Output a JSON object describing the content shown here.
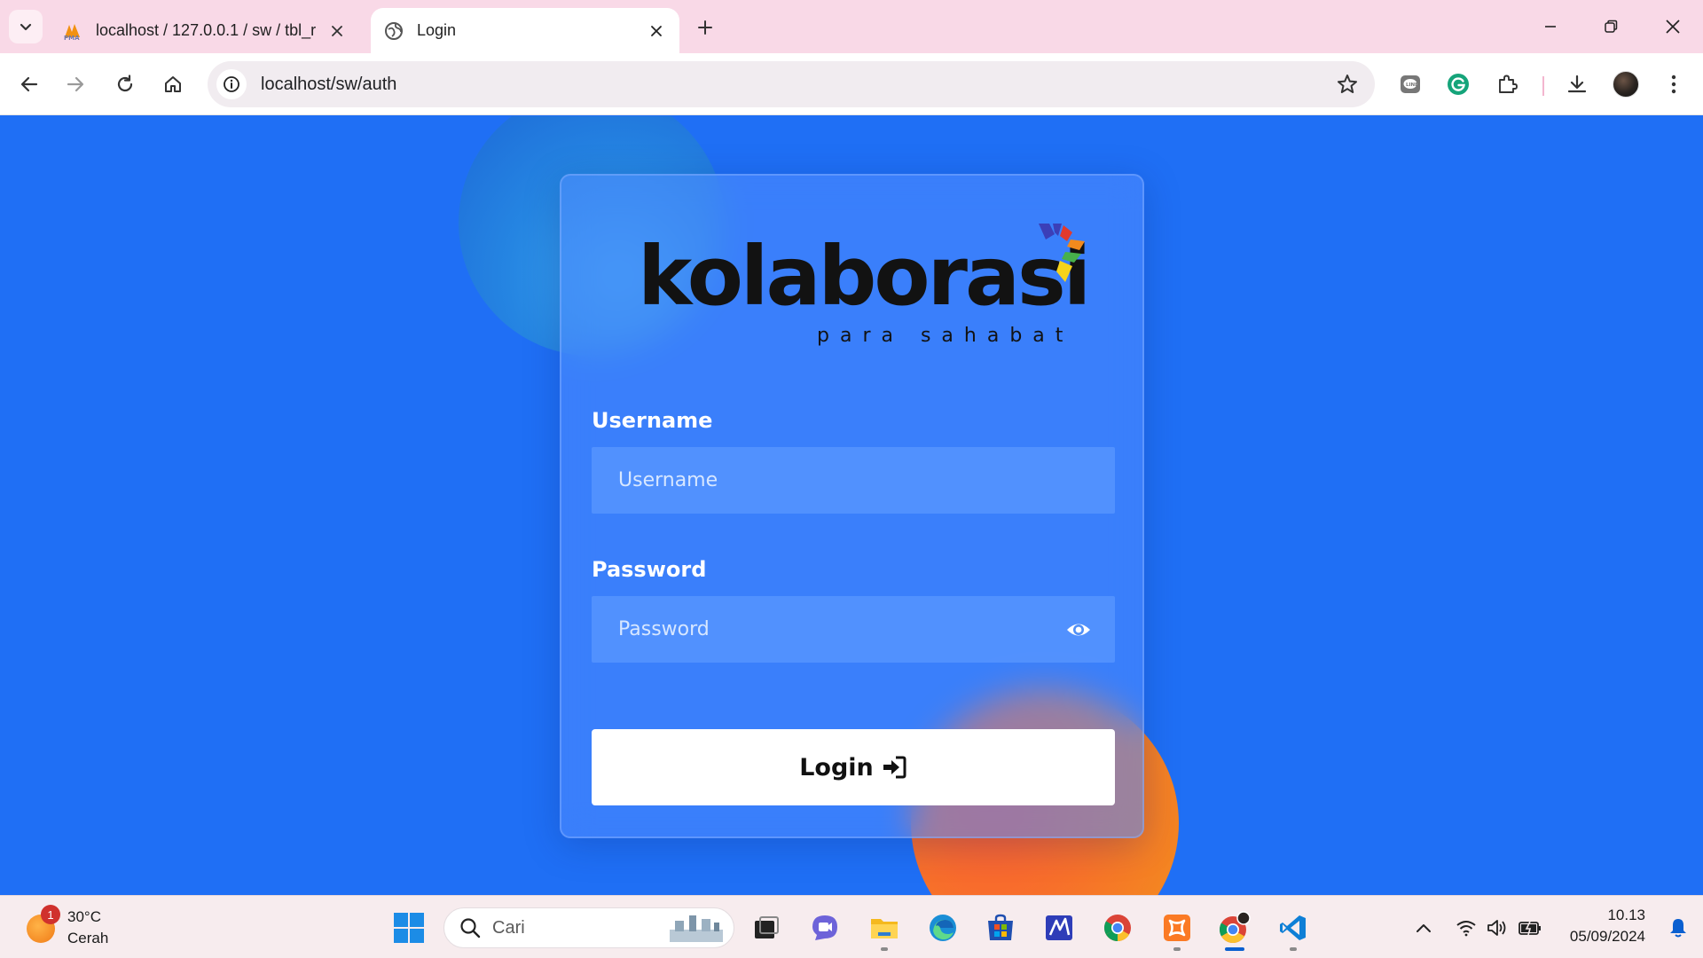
{
  "browser": {
    "tabs": [
      {
        "title": "localhost / 127.0.0.1 / sw / tbl_r",
        "favicon": "phpmyadmin-icon",
        "active": false
      },
      {
        "title": "Login",
        "favicon": "globe-icon",
        "active": true
      }
    ],
    "address": "localhost/sw/auth"
  },
  "login": {
    "logo_word": "kolaborasi",
    "logo_tagline": "para sahabat",
    "username_label": "Username",
    "username_placeholder": "Username",
    "password_label": "Password",
    "password_placeholder": "Password",
    "login_button": "Login",
    "colors": {
      "page_background": "#1f6ff5",
      "button_background": "#ffffff",
      "blob_blue": "#2585e2",
      "blob_orange": "#f7702a"
    }
  },
  "taskbar": {
    "weather_temp": "30°C",
    "weather_desc": "Cerah",
    "weather_badge": "1",
    "search_label": "Cari",
    "time": "10.13",
    "date": "05/09/2024"
  }
}
